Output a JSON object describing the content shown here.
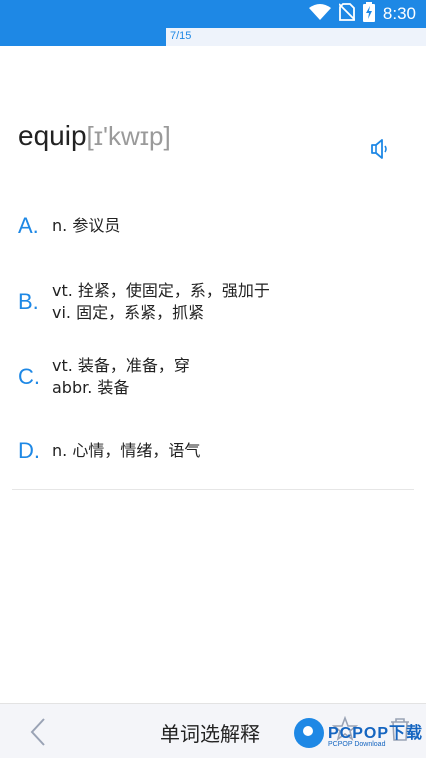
{
  "status_bar": {
    "time": "8:30",
    "icons": [
      "wifi-icon",
      "no-sim-icon",
      "battery-charging-icon"
    ]
  },
  "progress": {
    "text": "7/15",
    "fraction": 0.39
  },
  "word": {
    "text": "equip",
    "phonetic": "[ɪ'kwɪp]"
  },
  "options": [
    {
      "letter": "A.",
      "lines": [
        "n. 参议员"
      ]
    },
    {
      "letter": "B.",
      "lines": [
        "vt. 拴紧，使固定，系，强加于",
        "vi. 固定，系紧，抓紧"
      ]
    },
    {
      "letter": "C.",
      "lines": [
        "vt. 装备，准备，穿",
        "abbr. 装备"
      ]
    },
    {
      "letter": "D.",
      "lines": [
        "n. 心情，情绪，语气"
      ]
    }
  ],
  "bottom_bar": {
    "title": "单词选解释"
  },
  "watermark": {
    "main": "PCPOP下载",
    "sub": "PCPOP Download"
  },
  "colors": {
    "accent": "#1e88e5",
    "text": "#222222",
    "phonetic": "#9a9a9a"
  }
}
